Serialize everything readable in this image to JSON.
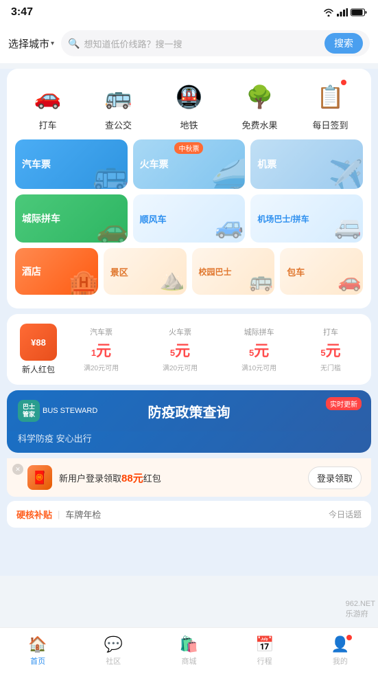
{
  "statusBar": {
    "time": "3:47",
    "icons": [
      "wifi",
      "signal",
      "battery"
    ]
  },
  "header": {
    "cityLabel": "选择城市",
    "searchPlaceholder": "想知道低价线路？搜一搜",
    "searchButton": "搜索"
  },
  "services": [
    {
      "id": "taxi",
      "label": "打车",
      "icon": "🚗"
    },
    {
      "id": "bus",
      "label": "查公交",
      "icon": "🚌"
    },
    {
      "id": "subway",
      "label": "地铁",
      "icon": "🚇"
    },
    {
      "id": "fruit",
      "label": "免费水果",
      "icon": "🌳"
    },
    {
      "id": "signin",
      "label": "每日签到",
      "icon": "📋"
    }
  ],
  "tickets": [
    {
      "id": "bus-ticket",
      "label": "汽车票",
      "color1": "#4badf5",
      "color2": "#2e94e0",
      "icon": "🚌"
    },
    {
      "id": "train-ticket",
      "label": "火车票",
      "badge": "中秋票",
      "color1": "#8ecef5",
      "color2": "#6cbce8",
      "icon": "✈️"
    },
    {
      "id": "plane-ticket",
      "label": "机票",
      "color1": "#b0d8f5",
      "color2": "#8ec8ef",
      "icon": "✈️"
    }
  ],
  "carpools": [
    {
      "id": "intercity",
      "label": "城际拼车",
      "type": "green",
      "icon": "🚗"
    },
    {
      "id": "rideshare",
      "label": "顺风车",
      "type": "light",
      "icon": "🚙"
    },
    {
      "id": "airport",
      "label": "机场巴士/拼车",
      "type": "light",
      "icon": "🚐"
    }
  ],
  "hotelRow": [
    {
      "id": "hotel",
      "label": "酒店",
      "type": "orange",
      "icon": "🏨"
    },
    {
      "id": "scenic",
      "label": "景区",
      "type": "light-orange",
      "icon": "⛰️"
    },
    {
      "id": "campus-bus",
      "label": "校园巴士",
      "type": "light-orange",
      "icon": "🚌"
    },
    {
      "id": "charter",
      "label": "包车",
      "type": "light-orange",
      "icon": "🚗"
    }
  ],
  "coupons": {
    "bagLabel": "¥88",
    "userLabel": "新人红包",
    "items": [
      {
        "type": "汽车票",
        "amount": "1",
        "unit": "元",
        "condition": "满20元可用"
      },
      {
        "type": "火车票",
        "amount": "5",
        "unit": "元",
        "condition": "满20元可用"
      },
      {
        "type": "城际拼车",
        "amount": "5",
        "unit": "元",
        "condition": "满10元可用"
      },
      {
        "type": "打车",
        "amount": "5",
        "unit": "元",
        "condition": "无门槛"
      }
    ]
  },
  "banner": {
    "logoIconText": "巴士\n管家",
    "logoSubText": "BUS STEWARD",
    "mainText": "防疫政策查询",
    "subText": "科学防疫 安心出行",
    "badgeText": "实时更新"
  },
  "notification": {
    "text": "新用户登录领取",
    "amount": "88元",
    "suffix": "红包",
    "buttonLabel": "登录领取"
  },
  "topics": {
    "label": "今日话题",
    "tags": []
  },
  "topicsExtra": {
    "leftLabel": "硬核补贴",
    "rightLabel": "车牌年检"
  },
  "bottomNav": [
    {
      "id": "home",
      "label": "首页",
      "icon": "🏠",
      "active": true
    },
    {
      "id": "community",
      "label": "社区",
      "icon": "💬",
      "active": false
    },
    {
      "id": "shop",
      "label": "商城",
      "icon": "🛍️",
      "active": false
    },
    {
      "id": "trip",
      "label": "行程",
      "icon": "📅",
      "active": false
    },
    {
      "id": "mine",
      "label": "我的",
      "icon": "👤",
      "active": false,
      "hasBadge": true
    }
  ],
  "colors": {
    "primary": "#2d8fef",
    "green": "#2db562",
    "orange": "#ff6020",
    "lightBlue": "#eef7ff",
    "lightOrange": "#fff3e8"
  }
}
